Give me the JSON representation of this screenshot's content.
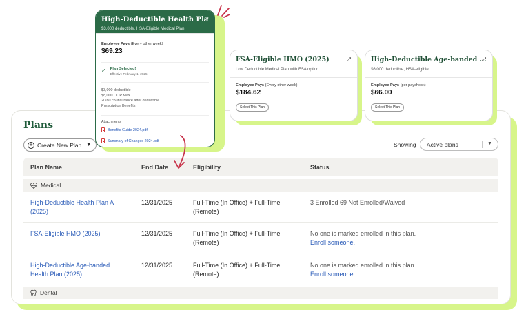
{
  "plans_panel": {
    "title": "Plans",
    "create_button": "Create New Plan",
    "showing_label": "Showing",
    "filter_value": "Active plans",
    "columns": [
      "Plan Name",
      "End Date",
      "Eligibility",
      "Status"
    ],
    "groups": {
      "medical": "Medical",
      "dental": "Dental"
    },
    "rows": [
      {
        "name_line1": "High-Deductible Health Plan A",
        "name_line2": "(2025)",
        "end_date": "12/31/2025",
        "elig_line1": "Full-Time (In Office) + Full-Time",
        "elig_line2": "(Remote)",
        "status_line1": "3 Enrolled 69 Not Enrolled/Waived",
        "status_link": ""
      },
      {
        "name_line1": "FSA-Eligible HMO (2025)",
        "name_line2": "",
        "end_date": "12/31/2025",
        "elig_line1": "Full-Time (In Office) + Full-Time",
        "elig_line2": "(Remote)",
        "status_line1": "No one is marked enrolled in this plan.",
        "status_link": "Enroll someone."
      },
      {
        "name_line1": "High-Deductible Age-banded",
        "name_line2": "Health Plan (2025)",
        "end_date": "12/31/2025",
        "elig_line1": "Full-Time (In Office) + Full-Time",
        "elig_line2": "(Remote)",
        "status_line1": "No one is marked enrolled in this plan.",
        "status_link": "Enroll someone."
      }
    ]
  },
  "cards": [
    {
      "title": "High-Deductible Health Plan ...",
      "subtitle": "$3,000 deductible, HSA-Eligible Medical Plan",
      "pays_label": "Employee Pays",
      "pays_freq": "(Every other week)",
      "price": "$69.23",
      "selected_title": "Plan Selected!",
      "selected_date": "Effective February 1, 2025",
      "details": [
        "$3,000 deductible",
        "$8,000 OOP Max",
        "20/80 co-insurance after deductible",
        "Prescription Benefits"
      ],
      "attachments_label": "Attachments",
      "attachments": [
        "Benefits Guide 2024.pdf",
        "Summary of Changes 2024.pdf"
      ]
    },
    {
      "title": "FSA-Eligible HMO (2025)",
      "subtitle": "Low Deductible Medical Plan with FSA option",
      "pays_label": "Employee Pays",
      "pays_freq": "(Every other week)",
      "price": "$184.62",
      "button": "Select This Plan"
    },
    {
      "title": "High-Deductible Age-banded ...",
      "subtitle": "$6,000 deductible, HSA-eligible",
      "pays_label": "Employee Pays",
      "pays_freq": "(per paycheck)",
      "price": "$66.00",
      "button": "Select This Plan"
    }
  ],
  "colors": {
    "brand_green": "#2b6b47",
    "accent_lime": "#d7f58a",
    "link_blue": "#2a5bb8",
    "arrow_red": "#c8344b"
  }
}
